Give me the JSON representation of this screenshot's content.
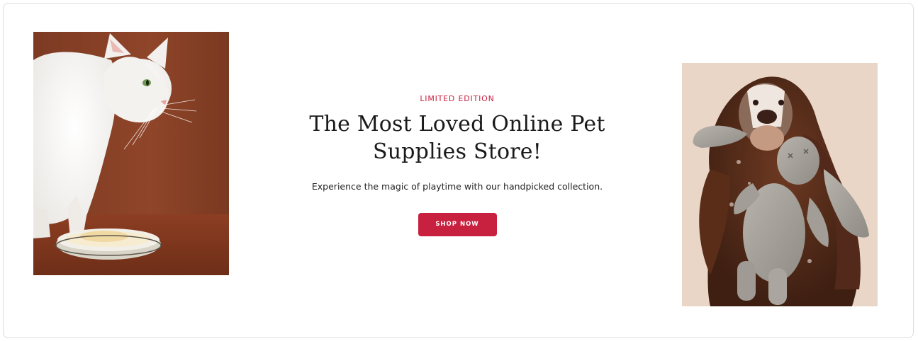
{
  "hero": {
    "eyebrow": "LIMITED EDITION",
    "headline": "The Most Loved Online Pet Supplies Store!",
    "subtext": "Experience the magic of playtime with our handpicked collection.",
    "cta_label": "SHOP NOW"
  },
  "images": {
    "left": "white-cat-with-food-bowl",
    "right": "spaniel-dog-with-plush-bunny"
  },
  "colors": {
    "accent": "#c8203f",
    "cat_background": "#8a4128",
    "dog_background": "#ead6c6"
  }
}
